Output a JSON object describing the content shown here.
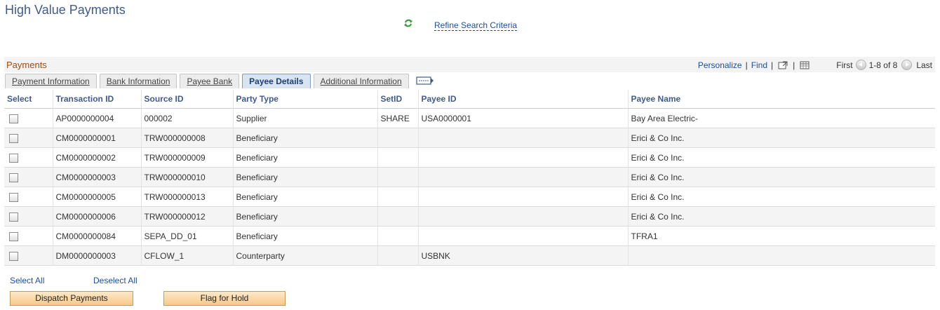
{
  "page": {
    "title": "High Value Payments",
    "refine_link": "Refine Search Criteria"
  },
  "grid": {
    "title": "Payments",
    "personalize": "Personalize",
    "find": "Find",
    "first": "First",
    "range": "1-8 of 8",
    "last": "Last"
  },
  "tabs": [
    {
      "label": "Payment Information",
      "active": false
    },
    {
      "label": "Bank Information",
      "active": false
    },
    {
      "label": "Payee Bank",
      "active": false
    },
    {
      "label": "Payee Details",
      "active": true
    },
    {
      "label": "Additional Information",
      "active": false
    }
  ],
  "table": {
    "columns": [
      "Select",
      "Transaction ID",
      "Source ID",
      "Party Type",
      "SetID",
      "Payee ID",
      "Payee Name"
    ],
    "rows": [
      {
        "transaction_id": "AP0000000004",
        "source_id": "000002",
        "party_type": "Supplier",
        "setid": "SHARE",
        "payee_id": "USA0000001",
        "payee_name": "Bay Area Electric-"
      },
      {
        "transaction_id": "CM0000000001",
        "source_id": "TRW000000008",
        "party_type": "Beneficiary",
        "setid": "",
        "payee_id": "",
        "payee_name": "Erici & Co Inc."
      },
      {
        "transaction_id": "CM0000000002",
        "source_id": "TRW000000009",
        "party_type": "Beneficiary",
        "setid": "",
        "payee_id": "",
        "payee_name": "Erici & Co Inc."
      },
      {
        "transaction_id": "CM0000000003",
        "source_id": "TRW000000010",
        "party_type": "Beneficiary",
        "setid": "",
        "payee_id": "",
        "payee_name": "Erici & Co Inc."
      },
      {
        "transaction_id": "CM0000000005",
        "source_id": "TRW000000013",
        "party_type": "Beneficiary",
        "setid": "",
        "payee_id": "",
        "payee_name": "Erici & Co Inc."
      },
      {
        "transaction_id": "CM0000000006",
        "source_id": "TRW000000012",
        "party_type": "Beneficiary",
        "setid": "",
        "payee_id": "",
        "payee_name": "Erici & Co Inc."
      },
      {
        "transaction_id": "CM0000000084",
        "source_id": "SEPA_DD_01",
        "party_type": "Beneficiary",
        "setid": "",
        "payee_id": "",
        "payee_name": "TFRA1"
      },
      {
        "transaction_id": "DM0000000003",
        "source_id": "CFLOW_1",
        "party_type": "Counterparty",
        "setid": "",
        "payee_id": "USBNK",
        "payee_name": ""
      }
    ]
  },
  "footer": {
    "select_all": "Select All",
    "deselect_all": "Deselect All",
    "dispatch_button": "Dispatch Payments",
    "hold_button": "Flag for Hold"
  },
  "colors": {
    "title": "#3f5b8e",
    "grid_title": "#a24b0f",
    "link": "#1c4fa0",
    "button": "#f7c98a"
  },
  "icons": [
    "refresh-icon",
    "zoom-grid-icon",
    "download-excel-icon",
    "previous-arrow-icon",
    "next-arrow-icon",
    "show-all-columns-icon"
  ]
}
